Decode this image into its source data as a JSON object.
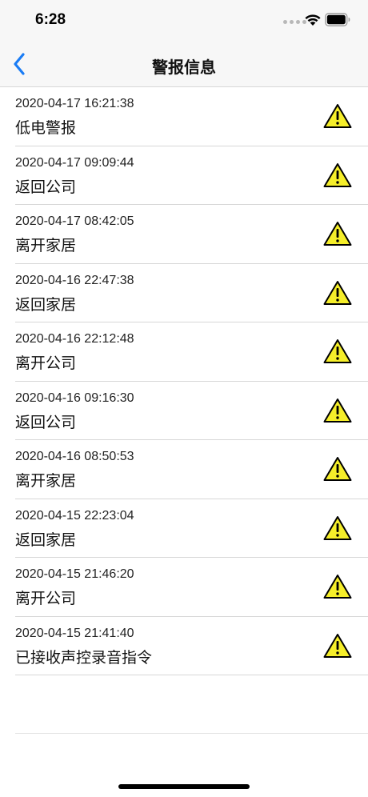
{
  "status_bar": {
    "time": "6:28"
  },
  "nav": {
    "title": "警报信息",
    "back_icon": "chevron-left-icon"
  },
  "colors": {
    "accent": "#1a7cf5",
    "warning_fill": "#f5ee2a",
    "separator": "#d7d7d7"
  },
  "alarms": [
    {
      "time": "2020-04-17 16:21:38",
      "title": "低电警报",
      "icon": "warning-icon"
    },
    {
      "time": "2020-04-17 09:09:44",
      "title": "返回公司",
      "icon": "warning-icon"
    },
    {
      "time": "2020-04-17 08:42:05",
      "title": "离开家居",
      "icon": "warning-icon"
    },
    {
      "time": "2020-04-16 22:47:38",
      "title": "返回家居",
      "icon": "warning-icon"
    },
    {
      "time": "2020-04-16 22:12:48",
      "title": "离开公司",
      "icon": "warning-icon"
    },
    {
      "time": "2020-04-16 09:16:30",
      "title": "返回公司",
      "icon": "warning-icon"
    },
    {
      "time": "2020-04-16 08:50:53",
      "title": "离开家居",
      "icon": "warning-icon"
    },
    {
      "time": "2020-04-15 22:23:04",
      "title": "返回家居",
      "icon": "warning-icon"
    },
    {
      "time": "2020-04-15 21:46:20",
      "title": "离开公司",
      "icon": "warning-icon"
    },
    {
      "time": "2020-04-15 21:41:40",
      "title": "已接收声控录音指令",
      "icon": "warning-icon"
    }
  ]
}
